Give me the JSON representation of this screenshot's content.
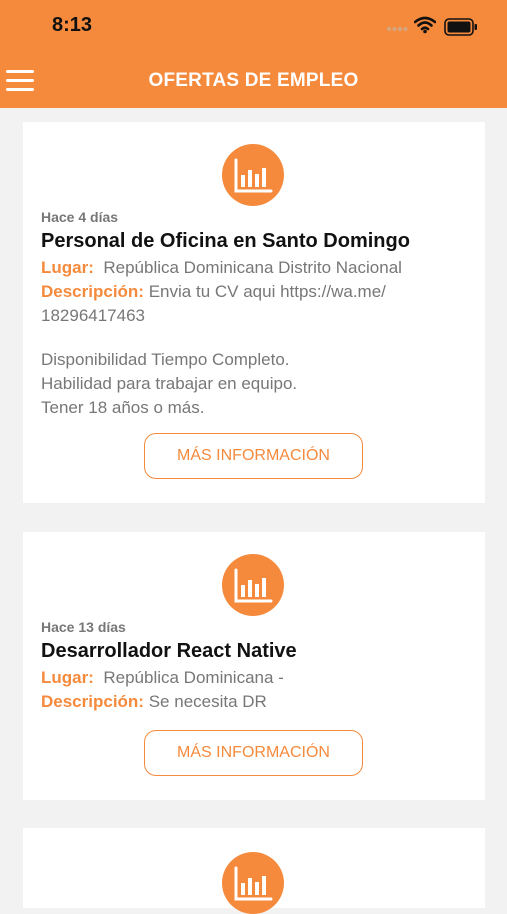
{
  "status_bar": {
    "time": "8:13"
  },
  "nav": {
    "title": "OFERTAS DE EMPLEO"
  },
  "jobs": [
    {
      "posted": "Hace 4 días",
      "title": "Personal de Oficina en Santo Domingo",
      "location_label": "Lugar:",
      "location": "República Dominicana Distrito Nacional",
      "description_label": "Descripción:",
      "description_first": "Envia tu CV aqui https://wa.me/",
      "description_second": "18296417463",
      "description_extra": [
        "Disponibilidad Tiempo Completo.",
        "Habilidad para trabajar en equipo.",
        "Tener 18 años o más."
      ],
      "button": "MÁS INFORMACIÓN"
    },
    {
      "posted": "Hace 13 días",
      "title": "Desarrollador React Native",
      "location_label": "Lugar:",
      "location": "República Dominicana -",
      "description_label": "Descripción:",
      "description_first": "Se necesita DR",
      "button": "MÁS INFORMACIÓN"
    }
  ],
  "colors": {
    "accent": "#f58a3c",
    "background": "#f2f2f2"
  },
  "icons": {
    "menu": "hamburger-menu-icon",
    "card": "bar-chart-icon"
  }
}
